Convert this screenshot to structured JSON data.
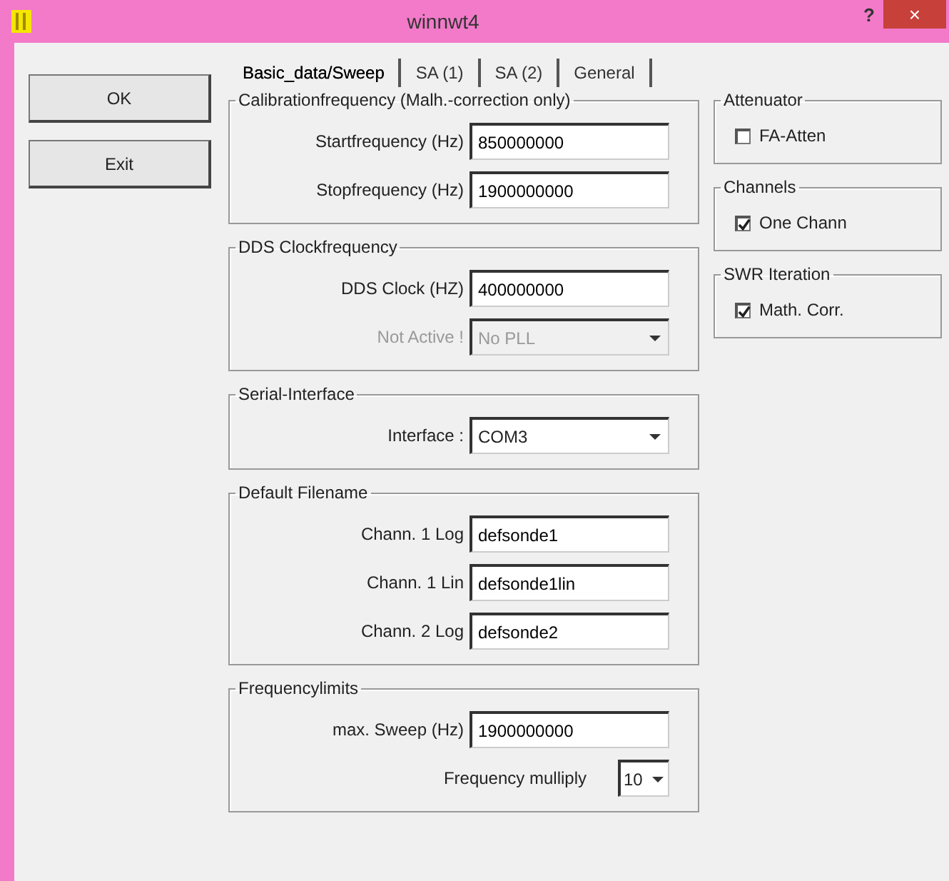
{
  "window": {
    "title": "winnwt4",
    "help": "?",
    "close": "×"
  },
  "buttons": [
    "OK",
    "Exit"
  ],
  "tabs": [
    {
      "label": "Basic_data/Sweep",
      "selected": true
    },
    {
      "label": "SA (1)",
      "selected": false
    },
    {
      "label": "SA (2)",
      "selected": false
    },
    {
      "label": "General",
      "selected": false
    }
  ],
  "left_groups": [
    {
      "title": "Calibrationfrequency (Malh.-correction only)",
      "rows": [
        {
          "kind": "text",
          "label": "Startfrequency (Hz)",
          "value": "850000000",
          "disabled": false
        },
        {
          "kind": "text",
          "label": "Stopfrequency (Hz)",
          "value": "1900000000",
          "disabled": false
        }
      ]
    },
    {
      "title": "DDS Clockfrequency",
      "rows": [
        {
          "kind": "text",
          "label": "DDS Clock (HZ)",
          "value": "400000000",
          "disabled": false
        },
        {
          "kind": "select",
          "label": "Not Active !",
          "value": "No PLL",
          "disabled": true
        }
      ]
    },
    {
      "title": "Serial-Interface",
      "rows": [
        {
          "kind": "select",
          "label": "Interface :",
          "value": "COM3",
          "disabled": false
        }
      ]
    },
    {
      "title": "Default Filename",
      "rows": [
        {
          "kind": "text",
          "label": "Chann. 1  Log",
          "value": "defsonde1",
          "disabled": false
        },
        {
          "kind": "text",
          "label": "Chann. 1  Lin",
          "value": "defsonde1lin",
          "disabled": false
        },
        {
          "kind": "text",
          "label": "Chann. 2 Log",
          "value": "defsonde2",
          "disabled": false
        }
      ]
    },
    {
      "title": "Frequencylimits",
      "rows": [
        {
          "kind": "text",
          "label": "max. Sweep (Hz)",
          "value": "1900000000",
          "disabled": false
        },
        {
          "kind": "small-select",
          "label": "Frequency mulliply",
          "value": "10",
          "disabled": false
        }
      ]
    }
  ],
  "right_groups": [
    {
      "title": "Attenuator",
      "rows": [
        {
          "kind": "checkbox",
          "label": "FA-Atten",
          "checked": false
        }
      ]
    },
    {
      "title": "Channels",
      "rows": [
        {
          "kind": "checkbox",
          "label": "One Chann",
          "checked": true
        }
      ]
    },
    {
      "title": "SWR Iteration",
      "rows": [
        {
          "kind": "checkbox",
          "label": "Math. Corr.",
          "checked": true
        }
      ]
    }
  ]
}
